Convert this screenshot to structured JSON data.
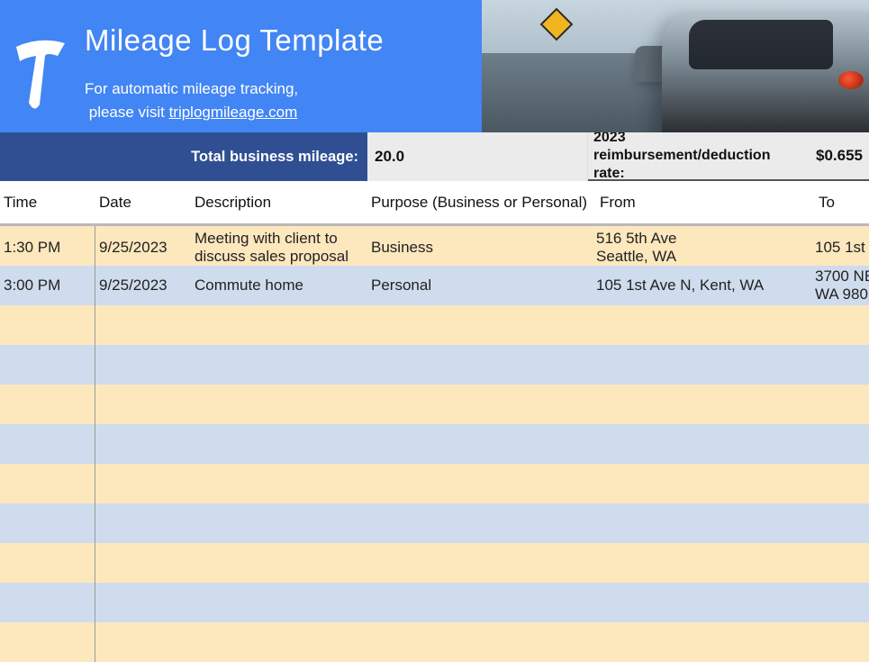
{
  "banner": {
    "title": "Mileage Log Template",
    "subtitle_line1": "For automatic mileage tracking,",
    "subtitle_line2_prefix": "please visit ",
    "subtitle_link_text": "triplogmileage.com"
  },
  "summary": {
    "label": "Total business mileage:",
    "value": "20.0",
    "rate_label": "2023 reimbursement/deduction rate:",
    "rate_value": "$0.655"
  },
  "columns": {
    "time": "Time",
    "date": "Date",
    "description": "Description",
    "purpose": "Purpose (Business or Personal)",
    "from": "From",
    "to": "To"
  },
  "rows": [
    {
      "time": "1:30 PM",
      "date": "9/25/2023",
      "description": "Meeting with client to discuss sales proposal",
      "purpose": "Business",
      "from": "516 5th Ave\nSeattle, WA",
      "to": "105 1st"
    },
    {
      "time": "3:00 PM",
      "date": "9/25/2023",
      "description": "Commute home",
      "purpose": "Personal",
      "from": "105 1st Ave N, Kent, WA",
      "to": "3700 NE\nWA 980"
    },
    {
      "time": "",
      "date": "",
      "description": "",
      "purpose": "",
      "from": "",
      "to": ""
    },
    {
      "time": "",
      "date": "",
      "description": "",
      "purpose": "",
      "from": "",
      "to": ""
    },
    {
      "time": "",
      "date": "",
      "description": "",
      "purpose": "",
      "from": "",
      "to": ""
    },
    {
      "time": "",
      "date": "",
      "description": "",
      "purpose": "",
      "from": "",
      "to": ""
    },
    {
      "time": "",
      "date": "",
      "description": "",
      "purpose": "",
      "from": "",
      "to": ""
    },
    {
      "time": "",
      "date": "",
      "description": "",
      "purpose": "",
      "from": "",
      "to": ""
    },
    {
      "time": "",
      "date": "",
      "description": "",
      "purpose": "",
      "from": "",
      "to": ""
    },
    {
      "time": "",
      "date": "",
      "description": "",
      "purpose": "",
      "from": "",
      "to": ""
    },
    {
      "time": "",
      "date": "",
      "description": "",
      "purpose": "",
      "from": "",
      "to": ""
    }
  ]
}
